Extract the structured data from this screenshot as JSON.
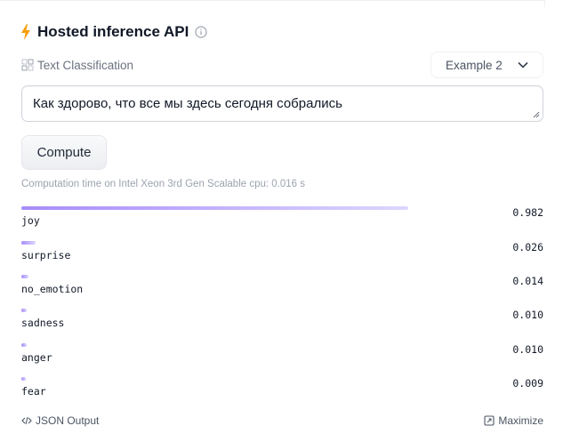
{
  "widget": {
    "title": "Hosted inference API",
    "task": "Text Classification",
    "example_select": "Example 2",
    "input_text": "Как здорово, что все мы здесь сегодня собрались",
    "compute_label": "Compute",
    "computation_time": "Computation time on Intel Xeon 3rd Gen Scalable cpu: 0.016 s"
  },
  "results": [
    {
      "label": "joy",
      "score": "0.982",
      "fraction": 0.982
    },
    {
      "label": "surprise",
      "score": "0.026",
      "fraction": 0.026
    },
    {
      "label": "no_emotion",
      "score": "0.014",
      "fraction": 0.014
    },
    {
      "label": "sadness",
      "score": "0.010",
      "fraction": 0.01
    },
    {
      "label": "anger",
      "score": "0.010",
      "fraction": 0.01
    },
    {
      "label": "fear",
      "score": "0.009",
      "fraction": 0.009
    }
  ],
  "footer": {
    "json_output": "JSON Output",
    "maximize": "Maximize"
  },
  "icons": {
    "bolt": "lightning-bolt-icon",
    "info": "info-circle-icon",
    "task": "text-classification-icon",
    "chevron": "chevron-down-icon",
    "code": "code-icon",
    "maximize": "maximize-icon"
  },
  "colors": {
    "bolt": "#f59e0b",
    "bar_start": "#a78bfa",
    "bar_end": "#ddd6fe"
  }
}
